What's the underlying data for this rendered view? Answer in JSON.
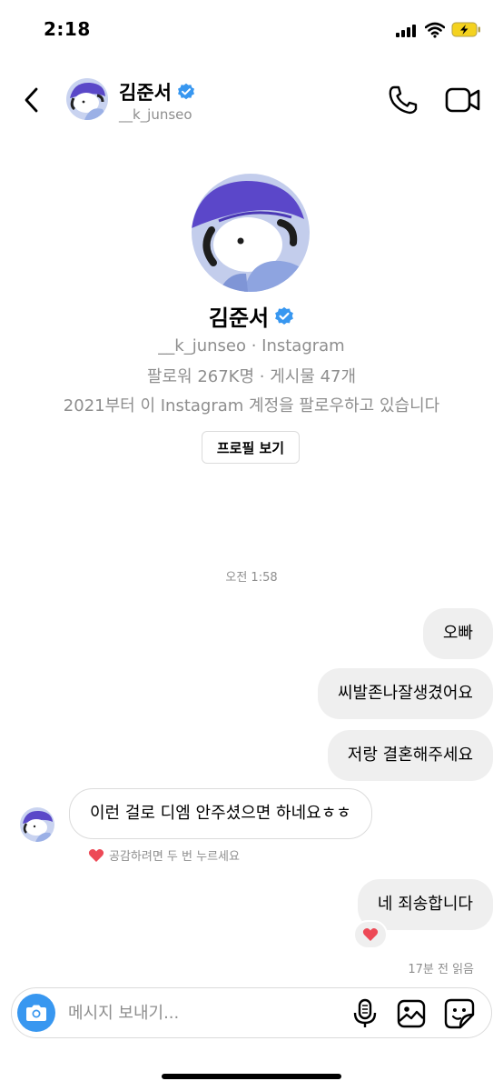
{
  "status_bar": {
    "time": "2:18"
  },
  "header": {
    "name": "김준서",
    "handle": "__k_junseo"
  },
  "profile": {
    "name": "김준서",
    "subtitle": "__k_junseo · Instagram",
    "stats": "팔로워 267K명 · 게시물 47개",
    "follow_since": "2021부터 이 Instagram 계정을 팔로우하고 있습니다",
    "view_profile_label": "프로필 보기"
  },
  "timestamp": "오전 1:58",
  "messages": [
    {
      "direction": "out",
      "text": "오빠"
    },
    {
      "direction": "out",
      "text": "씨발존나잘생겼어요"
    },
    {
      "direction": "out",
      "text": "저랑 결혼해주세요"
    },
    {
      "direction": "in",
      "text": "이런 걸로 디엠 안주셨으면 하네요ㅎㅎ"
    },
    {
      "direction": "out",
      "text": "네 죄송합니다"
    }
  ],
  "like_hint": "공감하려면 두 번 누르세요",
  "reaction": {
    "icon": "red-heart-icon",
    "color": "#ed4956"
  },
  "read_receipt": "17분 전 읽음",
  "composer": {
    "placeholder": "메시지 보내기..."
  },
  "colors": {
    "accent": "#3897f0",
    "verified": "#3897f0",
    "heart": "#ed4956",
    "bubble_out": "#efefef"
  }
}
